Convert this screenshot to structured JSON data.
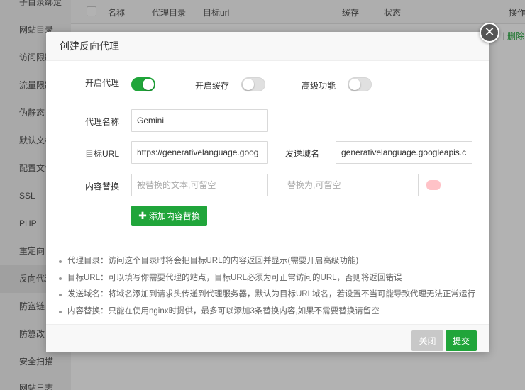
{
  "background": {
    "sidebar_items": [
      "子目录绑定",
      "网站目录",
      "访问限制",
      "流量限制",
      "伪静态",
      "默认文档",
      "配置文件",
      "SSL",
      "PHP",
      "重定向",
      "反向代理",
      "防盗链",
      "防篡改",
      "安全扫描",
      "网站日志"
    ],
    "table_headers": {
      "name": "名称",
      "proxy_dir": "代理目录",
      "target_url": "目标url",
      "cache": "缓存",
      "status": "状态",
      "action": "操作"
    },
    "row_separator": "|",
    "row_delete": "删除"
  },
  "dialog": {
    "title": "创建反向代理",
    "close_glyph": "✕",
    "toggles": {
      "enable_proxy": {
        "label": "开启代理",
        "on": true
      },
      "enable_cache": {
        "label": "开启缓存",
        "on": false
      },
      "advanced": {
        "label": "高级功能",
        "on": false
      }
    },
    "proxy_name": {
      "label": "代理名称",
      "value": "Gemini"
    },
    "target_url": {
      "label": "目标URL",
      "value": "https://generativelanguage.goog"
    },
    "send_domain": {
      "label": "发送域名",
      "value": "generativelanguage.googleapis.c"
    },
    "content_replace": {
      "label": "内容替换",
      "from_placeholder": "被替换的文本,可留空",
      "to_placeholder": "替换为,可留空"
    },
    "add_button": "添加内容替换",
    "notes": [
      "代理目录：访问这个目录时将会把目标URL的内容返回并显示(需要开启高级功能)",
      "目标URL：可以填写你需要代理的站点，目标URL必须为可正常访问的URL，否则将返回错误",
      "发送域名：将域名添加到请求头传递到代理服务器，默认为目标URL域名，若设置不当可能导致代理无法正常运行",
      "内容替换：只能在使用nginx时提供，最多可以添加3条替换内容,如果不需要替换请留空"
    ],
    "footer": {
      "close": "关闭",
      "submit": "提交"
    }
  },
  "colors": {
    "accent": "#20a53a",
    "disabled_button": "#c8c8c8"
  }
}
